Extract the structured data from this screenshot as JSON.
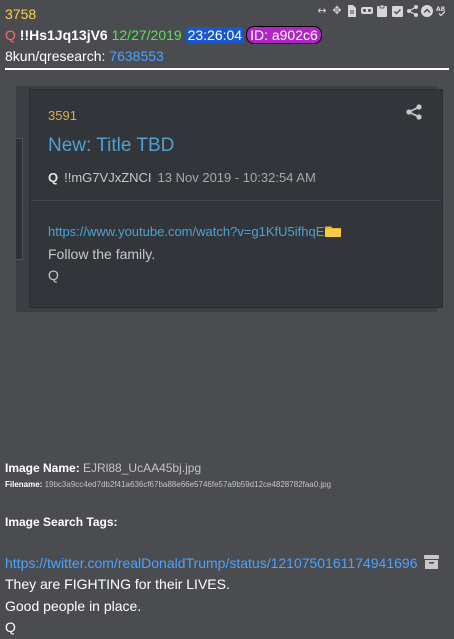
{
  "post": {
    "number": "3758",
    "q": "Q",
    "tripcode": "!!Hs1Jq13jV6",
    "date": "12/27/2019",
    "time": "23:26:04",
    "id": "ID: a902c6",
    "board": "8kun/qresearch:",
    "board_post": "7638553"
  },
  "toolbar": {
    "icons": [
      "resize-icon",
      "move-icon",
      "document-icon",
      "viewer-icon",
      "clipboard-icon",
      "checklist-icon",
      "share-icon",
      "collapse-icon",
      "spellcheck-icon"
    ]
  },
  "embed": {
    "number": "3591",
    "title": "New: Title TBD",
    "q": "Q",
    "tripcode": "!!mG7VJxZNCI",
    "date": "13 Nov 2019 - 10:32:54 AM",
    "link": "https://www.youtube.com/watch?v=g1KfU5ifhqE",
    "body1": "Follow the family.",
    "body2": "Q"
  },
  "image": {
    "name_label": "Image Name:",
    "name_value": "EJRl88_UcAA45bj.jpg",
    "filename_label": "Filename:",
    "filename_value": "19bc3a9cc4ed7db2f41a636cf67ba88e66e5746fe57a9b59d12ce4828782faa0.jpg",
    "search_tags_label": "Image Search Tags:"
  },
  "body": {
    "link": "https://twitter.com/realDonaldTrump/status/1210750161174941696",
    "lines": [
      "They are FIGHTING for their LIVES.",
      "Good people in place.",
      "Q"
    ]
  },
  "colors": {
    "background": "#4b4c50",
    "post_number": "#ffd24d",
    "date": "#5ce05c",
    "time_bg": "#1a57c9",
    "id_bg": "#b026c4",
    "link": "#4aa3ff"
  }
}
